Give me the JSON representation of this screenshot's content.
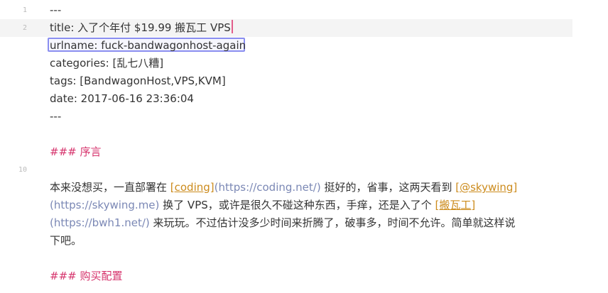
{
  "editor": {
    "lines": {
      "n1": "1",
      "n2": "2",
      "n10": "10"
    },
    "frontmatter": {
      "sep_open": "---",
      "title": "title: 入了个年付 $19.99 搬瓦工 VPS",
      "urlname": "urlname: fuck-bandwagonhost-again",
      "categories": "categories: [乱七八糟]",
      "tags": "tags: [BandwagonHost,VPS,KVM]",
      "date": "date: 2017-06-16 23:36:04",
      "sep_close": "---"
    },
    "heading_intro": "### 序言",
    "paragraph": {
      "t1": "本来没想买，一直部署在 ",
      "link1_text": "[coding]",
      "link1_url": "(https://coding.net/)",
      "t2": " 挺好的，省事，这两天看到 ",
      "link2_text": "[@skywing]",
      "link2_url": "(https://skywing.me)",
      "t3": " 换了 VPS，或许是很久不碰这种东西，手痒，还是入了个 ",
      "link3_text": "[搬瓦工]",
      "link3_url": "(https://bwh1.net/)",
      "t4": " 来玩玩。不过估计没多少时间来折腾了，破事多，时间不允许。简单就这样说",
      "t5": "下吧。"
    },
    "heading_buy": "### 购买配置"
  }
}
